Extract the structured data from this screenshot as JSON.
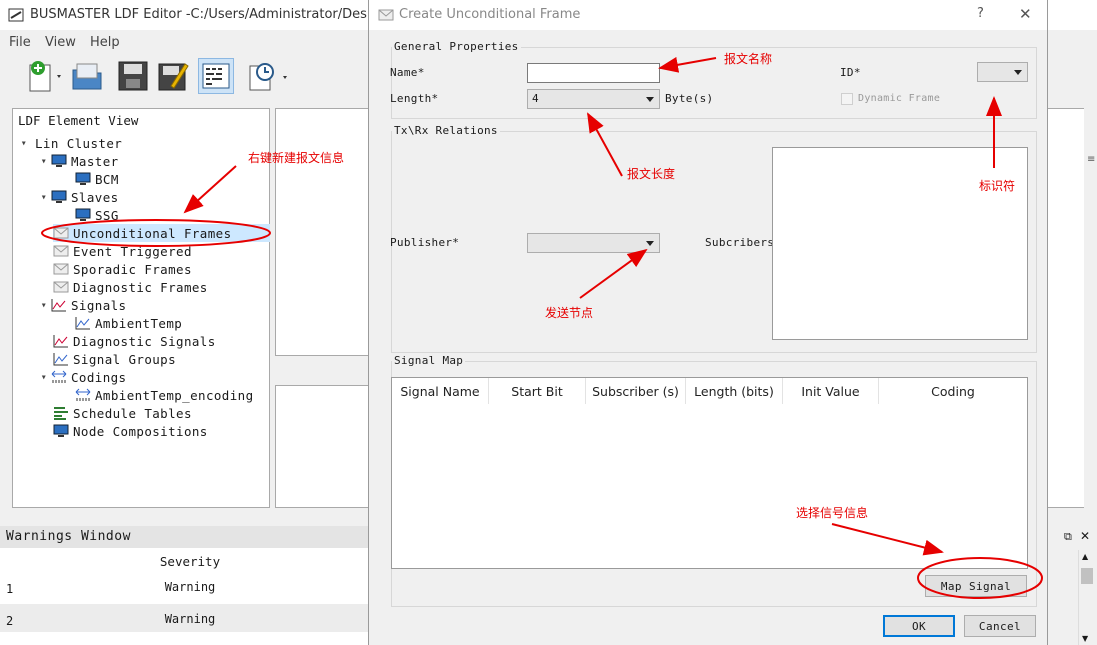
{
  "app": {
    "title": "BUSMASTER LDF Editor -C:/Users/Administrator/Desktop/",
    "menu": [
      "File",
      "View",
      "Help"
    ]
  },
  "tree": {
    "header": "LDF Element View",
    "items": [
      {
        "label": "Lin Cluster"
      },
      {
        "label": "Master"
      },
      {
        "label": "BCM"
      },
      {
        "label": "Slaves"
      },
      {
        "label": "SSG"
      },
      {
        "label": "Unconditional Frames"
      },
      {
        "label": "Event Triggered"
      },
      {
        "label": "Sporadic Frames"
      },
      {
        "label": "Diagnostic Frames"
      },
      {
        "label": "Signals"
      },
      {
        "label": "AmbientTemp"
      },
      {
        "label": "Diagnostic Signals"
      },
      {
        "label": "Signal Groups"
      },
      {
        "label": "Codings"
      },
      {
        "label": "AmbientTemp_encoding"
      },
      {
        "label": "Schedule Tables"
      },
      {
        "label": "Node Compositions"
      }
    ]
  },
  "warnings": {
    "title": "Warnings Window",
    "column": "Severity",
    "rows": [
      {
        "index": "1",
        "severity": "Warning"
      },
      {
        "index": "2",
        "severity": "Warning"
      }
    ]
  },
  "dialog": {
    "title": "Create Unconditional Frame",
    "help": "?",
    "close": "✕",
    "general": {
      "legend": "General Properties",
      "name_label": "Name*",
      "name_value": "",
      "length_label": "Length*",
      "length_value": "4",
      "length_unit": "Byte(s)",
      "id_label": "ID*",
      "id_value": "",
      "dynamic_label": "Dynamic Frame"
    },
    "txrx": {
      "legend": "Tx\\Rx Relations",
      "publisher_label": "Publisher*",
      "publisher_value": "",
      "subscribers_label": "Subcribers"
    },
    "signal_map": {
      "legend": "Signal Map",
      "columns": [
        "Signal Name",
        "Start Bit",
        "Subscriber (s)",
        "Length (bits)",
        "Init Value",
        "Coding"
      ],
      "map_button": "Map Signal"
    },
    "ok": "OK",
    "cancel": "Cancel"
  },
  "annotations": {
    "frame_name": "报文名称",
    "new_frame": "右键新建报文信息",
    "frame_length": "报文长度",
    "identifier": "标识符",
    "send_node": "发送节点",
    "select_signal": "选择信号信息"
  },
  "colors": {
    "annotation": "#e60000",
    "selection": "#cde8ff",
    "ok_border": "#0078d7"
  }
}
